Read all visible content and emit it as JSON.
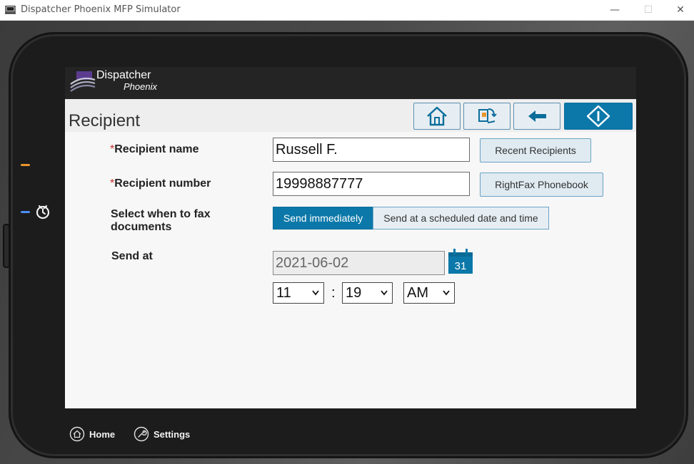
{
  "window": {
    "title": "Dispatcher Phoenix MFP Simulator",
    "minimize": "—",
    "maximize": "☐",
    "close": "✕"
  },
  "header": {
    "brand": "Dispatcher",
    "brand_sub": "Phoenix"
  },
  "page": {
    "title": "Recipient"
  },
  "nav": {
    "icons": [
      "home-icon",
      "swap-document-icon",
      "back-arrow-icon",
      "start-icon"
    ]
  },
  "form": {
    "recipient_name": {
      "required_mark": "*",
      "label": "Recipient name",
      "value": "Russell F.",
      "button": "Recent Recipients"
    },
    "recipient_number": {
      "required_mark": "*",
      "label": "Recipient number",
      "value": "19998887777",
      "button": "RightFax Phonebook"
    },
    "when": {
      "label": "Select when to fax documents",
      "options": [
        "Send immediately",
        "Send at a scheduled date and time"
      ],
      "selected": "Send immediately"
    },
    "send_at": {
      "label": "Send at",
      "date": "2021-06-02",
      "calendar_day": "31",
      "hour": "11",
      "separator": ":",
      "minute": "19",
      "ampm": "AM"
    }
  },
  "device_bar": {
    "home": "Home",
    "settings": "Settings"
  },
  "colors": {
    "accent": "#0b78a9",
    "required": "#c8302b",
    "led_orange": "#e8962c",
    "led_blue": "#4c8ef5"
  }
}
